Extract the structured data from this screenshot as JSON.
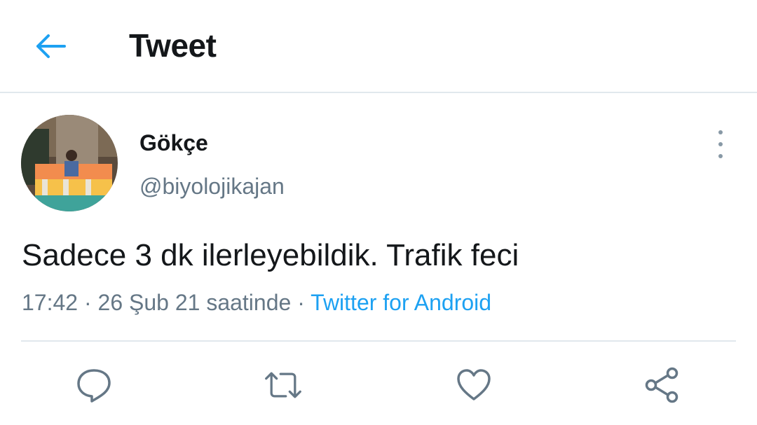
{
  "header": {
    "title": "Tweet",
    "back_icon": "arrow-left-icon",
    "accent_color": "#1da1f2"
  },
  "tweet": {
    "author": {
      "display_name": "Gökçe",
      "handle": "@biyolojikajan",
      "avatar_icon": "avatar-photo"
    },
    "more_icon": "vertical-ellipsis-icon",
    "text": "Sadece 3 dk ilerleyebildik. Trafik feci",
    "timestamp": "17:42 · 26 Şub 21 saatinde · ",
    "source": "Twitter for Android"
  },
  "actions": [
    {
      "name": "reply",
      "icon": "speech-bubble-icon"
    },
    {
      "name": "retweet",
      "icon": "retweet-icon"
    },
    {
      "name": "like",
      "icon": "heart-icon"
    },
    {
      "name": "share",
      "icon": "share-icon"
    }
  ],
  "colors": {
    "text_primary": "#14171a",
    "text_secondary": "#657786",
    "icon_gray": "#657786",
    "divider": "#e1e8ed",
    "link": "#1da1f2"
  }
}
